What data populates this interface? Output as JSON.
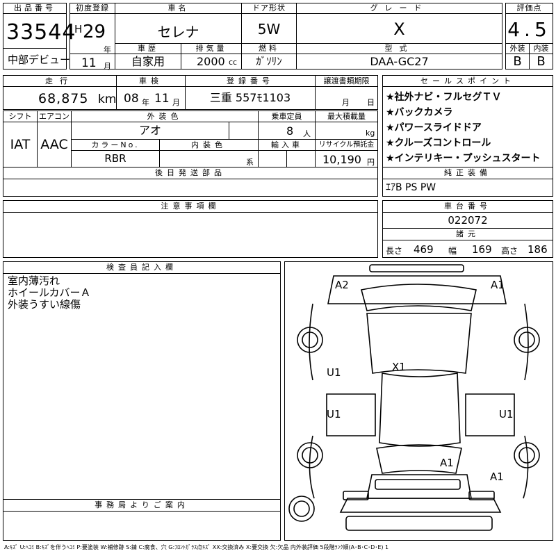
{
  "lot": {
    "label": "出品番号",
    "value": "33544",
    "venue": "中部デビュー"
  },
  "registration": {
    "label": "初度登録",
    "era": "H",
    "year": "29",
    "year_unit": "年",
    "month": "11",
    "month_unit": "月"
  },
  "car_name": {
    "label": "車名",
    "value": "セレナ"
  },
  "door": {
    "label": "ドア形状",
    "value": "5W"
  },
  "grade": {
    "label": "グレード",
    "value": "X"
  },
  "score": {
    "label": "評価点",
    "value": "4.5",
    "exterior_label": "外装",
    "exterior": "B",
    "interior_label": "内装",
    "interior": "B"
  },
  "history": {
    "label": "車歴",
    "value": "自家用"
  },
  "displacement": {
    "label": "排気量",
    "value": "2000",
    "unit": "cc"
  },
  "fuel": {
    "label": "燃料",
    "value": "ｶﾞｿﾘﾝ"
  },
  "model_code": {
    "label": "型式",
    "value": "DAA-GC27"
  },
  "mileage": {
    "label": "走行",
    "value": "68,875",
    "unit": "km"
  },
  "inspection": {
    "label": "車検",
    "year": "08",
    "year_unit": "年",
    "month": "11",
    "month_unit": "月"
  },
  "plate": {
    "label": "登録番号",
    "value": "三重 557ﾓ1103"
  },
  "transfer": {
    "label": "譲渡書類期限",
    "month_unit": "月",
    "day_unit": "日"
  },
  "shift": {
    "label": "シフト",
    "value": "IAT"
  },
  "aircon": {
    "label": "エアコン",
    "value": "AAC"
  },
  "ext_color": {
    "label": "外装色",
    "value": "アオ"
  },
  "capacity": {
    "label": "乗車定員",
    "value": "8",
    "unit": "人"
  },
  "max_load": {
    "label": "最大積載量",
    "unit": "kg"
  },
  "color_no": {
    "label": "カラーNo.",
    "value": "RBR"
  },
  "int_color": {
    "label": "内装色",
    "unit": "系"
  },
  "import": {
    "label": "輸入車"
  },
  "recycle": {
    "label": "リサイクル預託金",
    "value": "10,190",
    "unit": "円"
  },
  "later_parts": {
    "label": "後日発送部品"
  },
  "notes": {
    "label": "注意事項欄"
  },
  "sales_points": {
    "label": "セールスポイント",
    "items": [
      "★社外ナビ・フルセグＴＶ",
      "★バックカメラ",
      "★パワースライドドア",
      "★クルーズコントロール",
      "★インテリキー・プッシュスタート"
    ]
  },
  "equipment": {
    "label": "純正装備",
    "value": "ｴｱB PS PW"
  },
  "chassis": {
    "label": "車台番号",
    "value": "022072"
  },
  "dimensions": {
    "label": "諸元",
    "length_label": "長さ",
    "length": "469",
    "width_label": "幅",
    "width": "169",
    "height_label": "高さ",
    "height": "186"
  },
  "inspector": {
    "label": "検査員記入欄",
    "lines": [
      "室内薄汚れ",
      "ホイールカバーＡ",
      "外装うすい線傷"
    ]
  },
  "office": {
    "label": "事務局よりご案内"
  },
  "diagram_marks": {
    "a2_front_left": "A2",
    "a1_front_right": "A1",
    "x1_roof": "X1",
    "u1_left_front": "U1",
    "u1_left_rear": "U1",
    "u1_right_rear": "U1",
    "a1_rear_center": "A1",
    "a1_rear_right": "A1"
  },
  "legend": "A:ｷｽﾞ U:ﾍｺﾐ B:ｷｽﾞを伴うﾍｺﾐ P:要塗装 W:補修跡 S:錆 C:腐食、穴 G:ﾌﾛﾝﾄｶﾞﾗｽ点ｷｽﾞ XX:交換済み X:要交換 欠:欠品 内外装評価 5段階ﾗﾝｸ順(A･B･C･D･E) 1"
}
